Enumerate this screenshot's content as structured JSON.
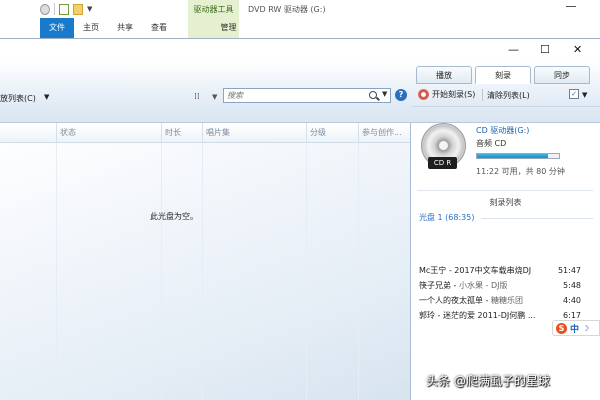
{
  "explorer": {
    "quick_access_icons": [
      "circle-icon",
      "checkmark-icon",
      "folder-icon",
      "pin-icon"
    ],
    "context_group": "驱动器工具",
    "window_title": "DVD RW 驱动器 (G:)",
    "tabs": [
      "文件",
      "主页",
      "共享",
      "查看"
    ],
    "context_tab": "管理"
  },
  "wmp": {
    "window_controls": {
      "minimize": "—",
      "maximize": "☐",
      "close": "✕"
    },
    "top_tabs": [
      "播放",
      "刻录",
      "同步"
    ],
    "active_tab": "刻录",
    "library": {
      "organize_label": "放列表(C)",
      "search_placeholder": "搜索",
      "columns": [
        "状态",
        "时长",
        "唱片集",
        "分级",
        "参与创作..."
      ],
      "empty_message": "此光盘为空。"
    },
    "burn": {
      "start_label": "开始刻录(S)",
      "clear_label": "清除列表(L)",
      "drive_name": "CD 驱动器(G:)",
      "disc_type": "音频 CD",
      "cd_badge": "CD R",
      "space_text": "11:22 可用，共 80 分钟",
      "used_fraction": 0.86,
      "list_title": "刻录列表",
      "disc_label": "光盘 1 (68:35)",
      "tracks": [
        {
          "title": "Mc王宁 - 2017中文车载串烧DJ",
          "artist": "",
          "duration": "51:47"
        },
        {
          "title": "筷子兄弟 - ",
          "artist": "小水果 - DJ版",
          "duration": "5:48"
        },
        {
          "title": "一个人的夜太孤单 - ",
          "artist": "糖糖乐团",
          "duration": "4:40"
        },
        {
          "title": "郭玲 - 迷茫的爱 2011-DJ何鹏 ...",
          "artist": "",
          "duration": "6:17"
        }
      ]
    }
  },
  "ime": {
    "mode": "中",
    "logo": "S",
    "moon": "☽"
  },
  "watermark": "头条 @爬满虱子的星球",
  "colors": {
    "accent": "#1979ca",
    "link": "#1d63b5",
    "progress": "#1b8ec9",
    "context_tab_bg": "#e4f0cf"
  }
}
